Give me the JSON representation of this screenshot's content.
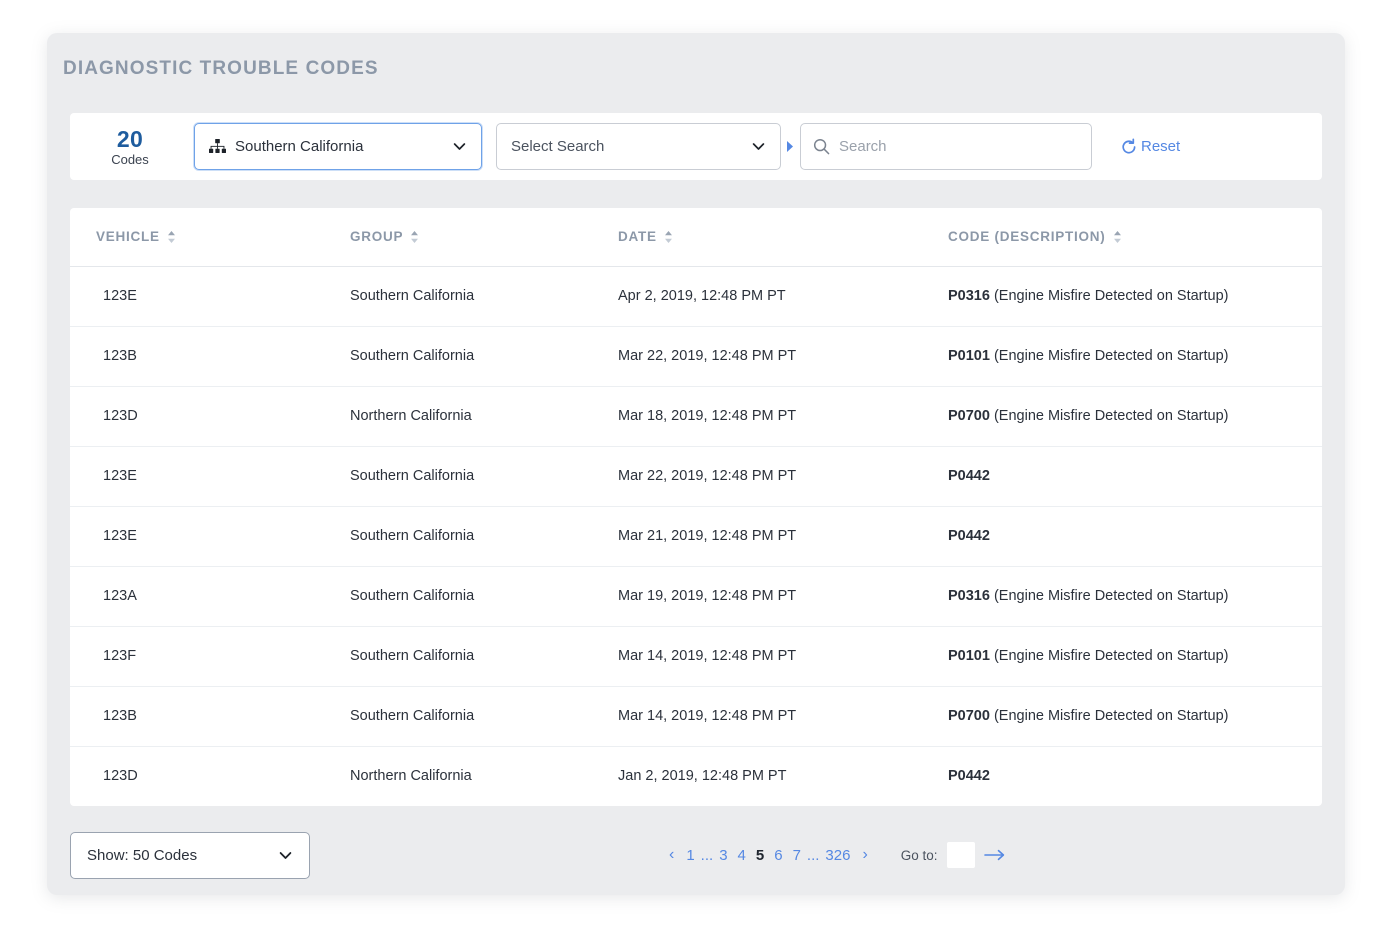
{
  "header": {
    "title": "DIAGNOSTIC TROUBLE CODES"
  },
  "toolbar": {
    "count": {
      "value": "20",
      "label": "Codes"
    },
    "org_filter": {
      "icon": "org-chart-icon",
      "value": "Southern California"
    },
    "search_type": {
      "value": "Select Search"
    },
    "search_input": {
      "icon": "search-icon",
      "value": "",
      "placeholder": "Search"
    },
    "reset": {
      "icon": "reset-icon",
      "label": "Reset"
    }
  },
  "table": {
    "columns": [
      {
        "key": "vehicle",
        "label": "VEHICLE",
        "sortable": true
      },
      {
        "key": "group",
        "label": "GROUP",
        "sortable": true
      },
      {
        "key": "date",
        "label": "DATE",
        "sortable": true
      },
      {
        "key": "code",
        "label": "CODE (DESCRIPTION)",
        "sortable": true
      }
    ],
    "rows": [
      {
        "vehicle": "123E",
        "group": "Southern California",
        "date": "Apr 2, 2019, 12:48 PM PT",
        "code_id": "P0316",
        "code_desc": " (Engine Misfire Detected on Startup)"
      },
      {
        "vehicle": "123B",
        "group": "Southern California",
        "date": "Mar 22, 2019, 12:48 PM PT",
        "code_id": "P0101",
        "code_desc": " (Engine Misfire Detected on Startup)"
      },
      {
        "vehicle": "123D",
        "group": "Northern  California",
        "date": "Mar 18, 2019, 12:48 PM PT",
        "code_id": "P0700",
        "code_desc": " (Engine Misfire Detected on Startup)"
      },
      {
        "vehicle": "123E",
        "group": "Southern California",
        "date": "Mar 22, 2019, 12:48 PM PT",
        "code_id": "P0442",
        "code_desc": ""
      },
      {
        "vehicle": "123E",
        "group": "Southern California",
        "date": "Mar 21, 2019, 12:48 PM PT",
        "code_id": "P0442",
        "code_desc": ""
      },
      {
        "vehicle": "123A",
        "group": "Southern California",
        "date": "Mar 19, 2019, 12:48 PM PT",
        "code_id": "P0316",
        "code_desc": " (Engine Misfire Detected on Startup)"
      },
      {
        "vehicle": "123F",
        "group": "Southern California",
        "date": "Mar 14, 2019, 12:48 PM PT",
        "code_id": "P0101",
        "code_desc": " (Engine Misfire Detected on Startup)"
      },
      {
        "vehicle": "123B",
        "group": "Southern California",
        "date": "Mar 14, 2019, 12:48 PM PT",
        "code_id": "P0700",
        "code_desc": " (Engine Misfire Detected on Startup)"
      },
      {
        "vehicle": "123D",
        "group": "Northern  California",
        "date": "Jan 2, 2019, 12:48 PM PT",
        "code_id": "P0442",
        "code_desc": ""
      }
    ]
  },
  "footer": {
    "page_size": {
      "value": "Show: 50 Codes"
    },
    "pagination": {
      "prev": "‹",
      "next": "›",
      "items": [
        {
          "label": "1",
          "type": "page"
        },
        {
          "label": "...",
          "type": "ellipsis"
        },
        {
          "label": "3",
          "type": "page"
        },
        {
          "label": "4",
          "type": "page"
        },
        {
          "label": "5",
          "type": "current"
        },
        {
          "label": "6",
          "type": "page"
        },
        {
          "label": "7",
          "type": "page"
        },
        {
          "label": "...",
          "type": "ellipsis"
        },
        {
          "label": "326",
          "type": "page"
        }
      ],
      "current_page": "5",
      "last_page": "326"
    },
    "goto": {
      "label": "Go to:",
      "value": "",
      "placeholder": "",
      "arrow_icon": "arrow-right-icon"
    }
  },
  "colors": {
    "page_background": "#ffffff",
    "card_background": "#ebecee",
    "panel_background": "#ffffff",
    "title_text": "#8c98a8",
    "accent_blue": "#5588e3",
    "count_blue": "#1e5c9e",
    "body_text": "#2b313b",
    "border": "#c9cdd4",
    "row_divider": "#eceff2"
  }
}
